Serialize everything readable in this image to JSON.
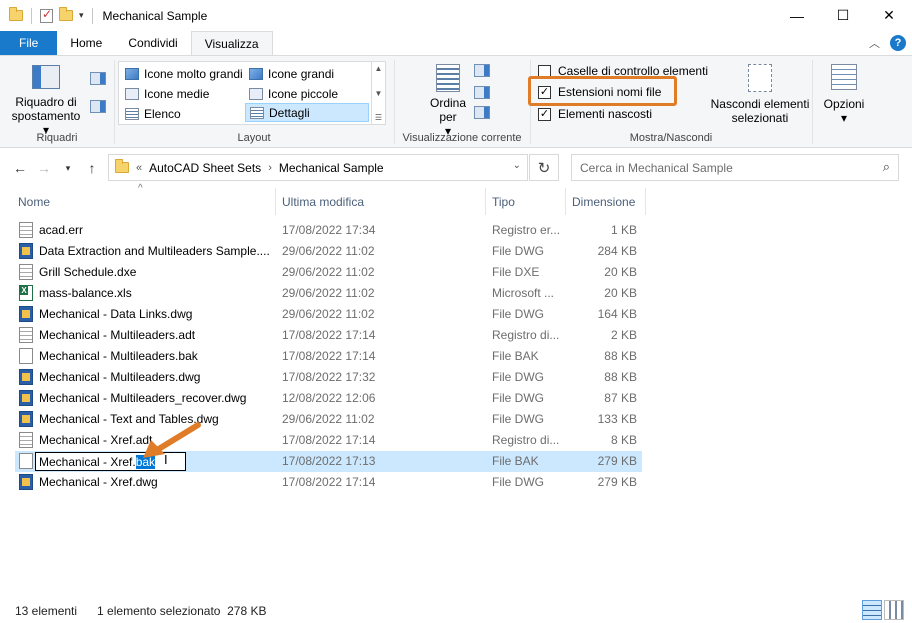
{
  "window": {
    "title": "Mechanical Sample",
    "minimize": "—",
    "maximize": "☐",
    "close": "✕"
  },
  "ribbon_tabs": [
    "File",
    "Home",
    "Condividi",
    "Visualizza"
  ],
  "ribbon": {
    "panes": {
      "nav_pane_label": "Riquadro di spostamento",
      "nav_pane_arrow": "▾",
      "group_label": "Riquadri"
    },
    "layout": {
      "items": [
        "Icone molto grandi",
        "Icone grandi",
        "Icone medie",
        "Icone piccole",
        "Elenco",
        "Dettagli"
      ],
      "selected": "Dettagli",
      "group_label": "Layout"
    },
    "current_view": {
      "sort_label": "Ordina per",
      "sort_arrow": "▾",
      "group_label": "Visualizzazione corrente"
    },
    "show_hide": {
      "checkboxes": [
        {
          "label": "Caselle di controllo elementi",
          "checked": false
        },
        {
          "label": "Estensioni nomi file",
          "checked": true
        },
        {
          "label": "Elementi nascosti",
          "checked": true
        }
      ],
      "hide_selected_label": "Nascondi elementi selezionati",
      "options_label": "Opzioni",
      "options_arrow": "▾",
      "group_label": "Mostra/Nascondi"
    }
  },
  "address": {
    "overflow": "«",
    "crumbs": [
      "AutoCAD Sheet Sets",
      "Mechanical Sample"
    ],
    "separator": "›",
    "search_placeholder": "Cerca in Mechanical Sample"
  },
  "columns": {
    "name": "Nome",
    "modified": "Ultima modifica",
    "type": "Tipo",
    "size": "Dimensione"
  },
  "files": [
    {
      "name": "acad.err",
      "modified": "17/08/2022 17:34",
      "type": "Registro er...",
      "size": "1 KB",
      "icon": "txt-file-icon"
    },
    {
      "name": "Data Extraction and Multileaders Sample....",
      "modified": "29/06/2022 11:02",
      "type": "File DWG",
      "size": "284 KB",
      "icon": "dwg-file-icon"
    },
    {
      "name": "Grill Schedule.dxe",
      "modified": "29/06/2022 11:02",
      "type": "File DXE",
      "size": "20 KB",
      "icon": "txt-file-icon"
    },
    {
      "name": "mass-balance.xls",
      "modified": "29/06/2022 11:02",
      "type": "Microsoft ...",
      "size": "20 KB",
      "icon": "xls-file-icon"
    },
    {
      "name": "Mechanical - Data Links.dwg",
      "modified": "29/06/2022 11:02",
      "type": "File DWG",
      "size": "164 KB",
      "icon": "dwg-file-icon"
    },
    {
      "name": "Mechanical - Multileaders.adt",
      "modified": "17/08/2022 17:14",
      "type": "Registro di...",
      "size": "2 KB",
      "icon": "txt-file-icon"
    },
    {
      "name": "Mechanical - Multileaders.bak",
      "modified": "17/08/2022 17:14",
      "type": "File BAK",
      "size": "88 KB",
      "icon": "blank-file-icon"
    },
    {
      "name": "Mechanical - Multileaders.dwg",
      "modified": "17/08/2022 17:32",
      "type": "File DWG",
      "size": "88 KB",
      "icon": "dwg-file-icon"
    },
    {
      "name": "Mechanical - Multileaders_recover.dwg",
      "modified": "12/08/2022 12:06",
      "type": "File DWG",
      "size": "87 KB",
      "icon": "dwg-file-icon"
    },
    {
      "name": "Mechanical - Text and Tables.dwg",
      "modified": "29/06/2022 11:02",
      "type": "File DWG",
      "size": "133 KB",
      "icon": "dwg-file-icon"
    },
    {
      "name": "Mechanical - Xref.adt",
      "modified": "17/08/2022 17:14",
      "type": "Registro di...",
      "size": "8 KB",
      "icon": "txt-file-icon"
    },
    {
      "name": "Mechanical - Xref.bak",
      "modified": "17/08/2022 17:13",
      "type": "File BAK",
      "size": "279 KB",
      "icon": "blank-file-icon"
    },
    {
      "name": "Mechanical - Xref.dwg",
      "modified": "17/08/2022 17:14",
      "type": "File DWG",
      "size": "279 KB",
      "icon": "dwg-file-icon"
    }
  ],
  "rename": {
    "prefix": "Mechanical - Xref.",
    "selected_ext": "bak"
  },
  "status": {
    "count": "13 elementi",
    "selection": "1 elemento selezionato  278 KB"
  },
  "colors": {
    "accent": "#1979ca",
    "selection": "#cce8ff",
    "highlight_box": "#e07b28",
    "arrow": "#e07b28"
  }
}
